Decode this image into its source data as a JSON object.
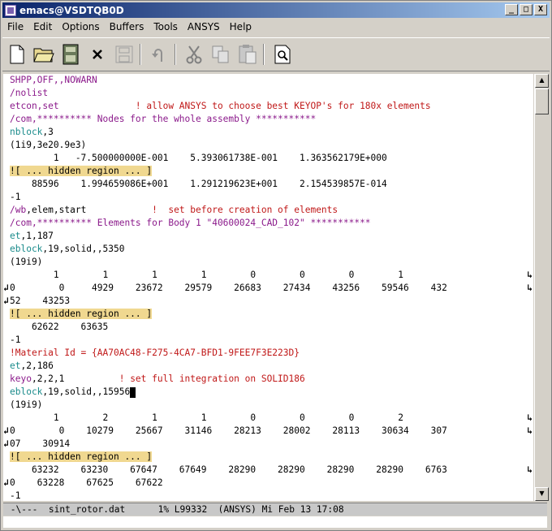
{
  "window": {
    "title": "emacs@VSDTQB0D",
    "buttons": [
      "_",
      "□",
      "X"
    ]
  },
  "menu": [
    "File",
    "Edit",
    "Options",
    "Buffers",
    "Tools",
    "ANSYS",
    "Help"
  ],
  "toolbar": [
    "new-file",
    "open-folder",
    "save-disk",
    "close",
    "save-disabled",
    "undo",
    "cut",
    "copy",
    "paste",
    "search"
  ],
  "colors": {
    "keyword": "#8b1a8b",
    "comment": "#c01818",
    "command": "#1a8b8b",
    "text": "#000000",
    "hidden_bg": "#f0d890"
  },
  "lines": [
    {
      "segments": [
        {
          "t": "SHPP,OFF,,NOWARN",
          "c": "keyword"
        }
      ]
    },
    {
      "segments": [
        {
          "t": "/nolist",
          "c": "keyword"
        }
      ]
    },
    {
      "segments": [
        {
          "t": "etcon,set",
          "c": "keyword"
        },
        {
          "t": "              ! allow ANSYS to choose best KEYOP's for 180x elements",
          "c": "comment"
        }
      ]
    },
    {
      "segments": [
        {
          "t": "/com,********** Nodes for the whole assembly ***********",
          "c": "keyword"
        }
      ]
    },
    {
      "segments": [
        {
          "t": "nblock",
          "c": "command"
        },
        {
          "t": ",3",
          "c": "text"
        }
      ]
    },
    {
      "segments": [
        {
          "t": "(1i9,3e20.9e3)",
          "c": "text"
        }
      ]
    },
    {
      "segments": [
        {
          "t": "        1   -7.500000000E-001    5.393061738E-001    1.363562179E+000",
          "c": "text"
        }
      ]
    },
    {
      "segments": [
        {
          "t": "![ ... hidden region ... ]",
          "c": "text",
          "hidden": true
        }
      ]
    },
    {
      "segments": [
        {
          "t": "    88596    1.994659086E+001    1.291219623E+001    2.154539857E-014",
          "c": "text"
        }
      ]
    },
    {
      "segments": [
        {
          "t": "-1",
          "c": "text"
        }
      ]
    },
    {
      "segments": [
        {
          "t": "/wb",
          "c": "keyword"
        },
        {
          "t": ",elem,start",
          "c": "text"
        },
        {
          "t": "            !  set before creation of elements",
          "c": "comment"
        }
      ]
    },
    {
      "segments": [
        {
          "t": "/com,********** Elements for Body 1 \"40600024_CAD_102\" ***********",
          "c": "keyword"
        }
      ]
    },
    {
      "segments": [
        {
          "t": "et",
          "c": "command"
        },
        {
          "t": ",1,187",
          "c": "text"
        }
      ]
    },
    {
      "segments": [
        {
          "t": "eblock",
          "c": "command"
        },
        {
          "t": ",19,solid,,5350",
          "c": "text"
        }
      ]
    },
    {
      "segments": [
        {
          "t": "(19i9)",
          "c": "text"
        }
      ]
    },
    {
      "segments": [
        {
          "t": "        1        1        1        1        0        0        0        1",
          "c": "text"
        }
      ],
      "wrap": "end"
    },
    {
      "segments": [
        {
          "t": "0        0     4929    23672    29579    26683    27434    43256    59546    432",
          "c": "text"
        }
      ],
      "wrap": "both"
    },
    {
      "segments": [
        {
          "t": "52    43253",
          "c": "text"
        }
      ],
      "wrap": "start"
    },
    {
      "segments": [
        {
          "t": "![ ... hidden region ... ]",
          "c": "text",
          "hidden": true
        }
      ]
    },
    {
      "segments": [
        {
          "t": "    62622    63635",
          "c": "text"
        }
      ]
    },
    {
      "segments": [
        {
          "t": "-1",
          "c": "text"
        }
      ]
    },
    {
      "segments": [
        {
          "t": "!Material Id = {AA70AC48-F275-4CA7-BFD1-9FEE7F3E223D}",
          "c": "comment"
        }
      ]
    },
    {
      "segments": [
        {
          "t": "et",
          "c": "command"
        },
        {
          "t": ",2,186",
          "c": "text"
        }
      ]
    },
    {
      "segments": [
        {
          "t": "keyo",
          "c": "keyword"
        },
        {
          "t": ",2,2,1",
          "c": "text"
        },
        {
          "t": "          ! set full integration on SOLID186",
          "c": "comment"
        }
      ]
    },
    {
      "segments": [
        {
          "t": "eblock",
          "c": "command"
        },
        {
          "t": ",19,solid,,15956",
          "c": "text"
        }
      ],
      "cursor": true
    },
    {
      "segments": [
        {
          "t": "(19i9)",
          "c": "text"
        }
      ]
    },
    {
      "segments": [
        {
          "t": "        1        2        1        1        0        0        0        2",
          "c": "text"
        }
      ],
      "wrap": "end"
    },
    {
      "segments": [
        {
          "t": "0        0    10279    25667    31146    28213    28002    28113    30634    307",
          "c": "text"
        }
      ],
      "wrap": "both"
    },
    {
      "segments": [
        {
          "t": "07    30914",
          "c": "text"
        }
      ],
      "wrap": "start"
    },
    {
      "segments": [
        {
          "t": "![ ... hidden region ... ]",
          "c": "text",
          "hidden": true
        }
      ]
    },
    {
      "segments": [
        {
          "t": "    63232    63230    67647    67649    28290    28290    28290    28290    6763",
          "c": "text"
        }
      ],
      "wrap": "end"
    },
    {
      "segments": [
        {
          "t": "0    63228    67625    67622",
          "c": "text"
        }
      ],
      "wrap": "start"
    },
    {
      "segments": [
        {
          "t": "-1",
          "c": "text"
        }
      ]
    }
  ],
  "modeline": " -\\---  sint_rotor.dat      1% L99332  (ANSYS) Mi Feb 13 17:08"
}
